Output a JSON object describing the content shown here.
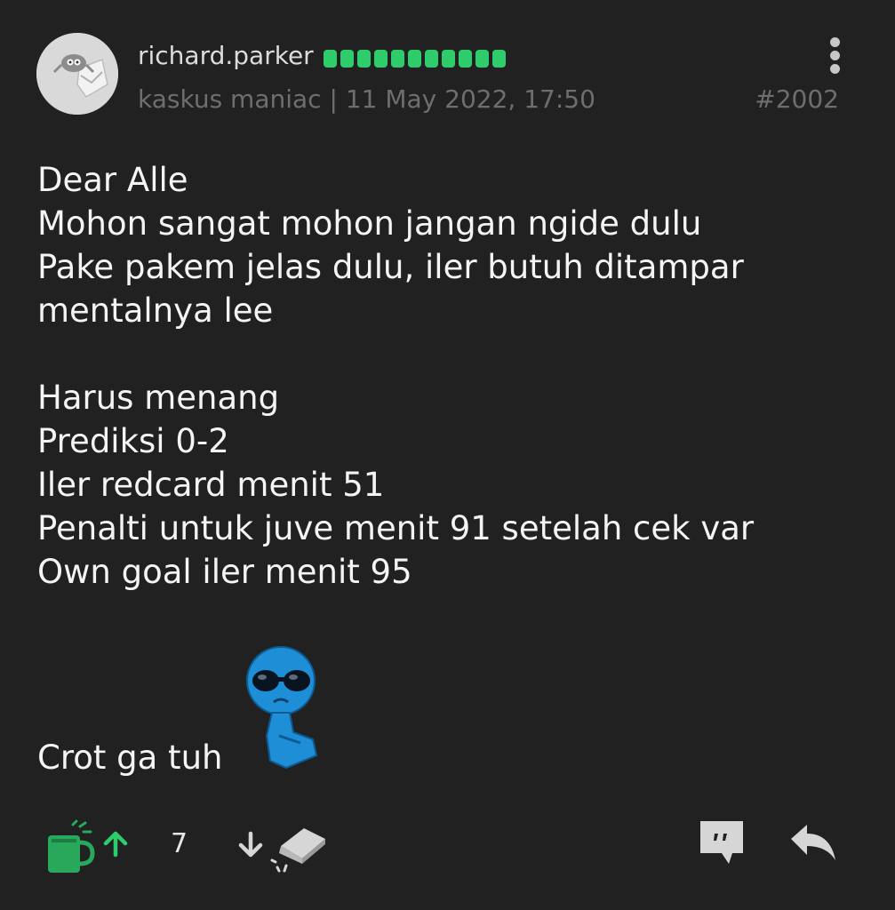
{
  "post": {
    "username": "richard.parker",
    "reputation_bars": 11,
    "rank": "kaskus maniac",
    "separator": "|",
    "date": "11 May 2022, 17:50",
    "post_number": "#2002",
    "body_lines_1": [
      "Dear Alle",
      "Mohon sangat mohon jangan ngide dulu",
      "Pake pakem jelas dulu, iler butuh ditampar",
      "mentalnya lee"
    ],
    "body_lines_2": [
      "Harus menang",
      "Prediksi 0-2",
      "Iler redcard menit 51",
      "Penalti untuk juve menit 91 setelah cek var",
      "Own goal iler menit 95"
    ],
    "last_line": "Crot ga tuh"
  },
  "footer": {
    "vote_count": "7"
  },
  "icons": {
    "avatar": "avatar-image",
    "more": "more-vertical-icon",
    "cup": "hot-cup-icon",
    "upvote": "arrow-up-icon",
    "downvote": "arrow-down-icon",
    "eraser": "eraser-icon",
    "quote": "quote-icon",
    "reply": "reply-icon"
  },
  "colors": {
    "background": "#212121",
    "rep_green": "#2ecc6a",
    "cup_green": "#27a85b",
    "meta_gray": "#6e6e6e"
  }
}
